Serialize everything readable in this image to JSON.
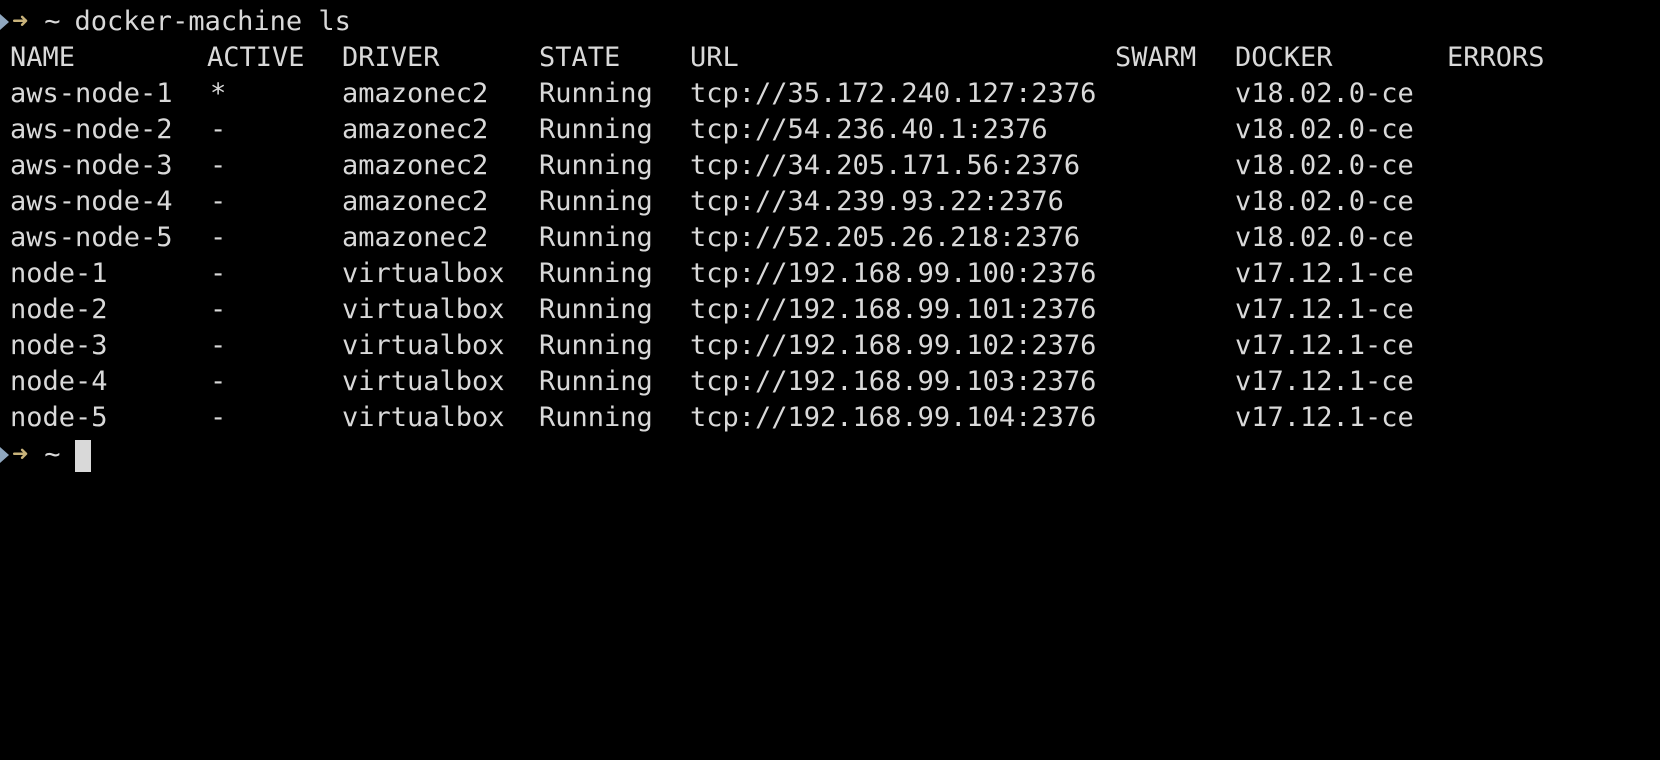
{
  "terminal": {
    "prompt": {
      "arrow": "➜",
      "tilde": "~",
      "command": "docker-machine ls"
    },
    "final_prompt": {
      "arrow": "➜",
      "tilde": "~"
    },
    "columns": [
      "NAME",
      "ACTIVE",
      "DRIVER",
      "STATE",
      "URL",
      "SWARM",
      "DOCKER",
      "ERRORS"
    ],
    "rows": [
      {
        "name": "aws-node-1",
        "active": "*",
        "driver": "amazonec2",
        "state": "Running",
        "url": "tcp://35.172.240.127:2376",
        "swarm": "",
        "docker": "v18.02.0-ce",
        "errors": ""
      },
      {
        "name": "aws-node-2",
        "active": "-",
        "driver": "amazonec2",
        "state": "Running",
        "url": "tcp://54.236.40.1:2376",
        "swarm": "",
        "docker": "v18.02.0-ce",
        "errors": ""
      },
      {
        "name": "aws-node-3",
        "active": "-",
        "driver": "amazonec2",
        "state": "Running",
        "url": "tcp://34.205.171.56:2376",
        "swarm": "",
        "docker": "v18.02.0-ce",
        "errors": ""
      },
      {
        "name": "aws-node-4",
        "active": "-",
        "driver": "amazonec2",
        "state": "Running",
        "url": "tcp://34.239.93.22:2376",
        "swarm": "",
        "docker": "v18.02.0-ce",
        "errors": ""
      },
      {
        "name": "aws-node-5",
        "active": "-",
        "driver": "amazonec2",
        "state": "Running",
        "url": "tcp://52.205.26.218:2376",
        "swarm": "",
        "docker": "v18.02.0-ce",
        "errors": ""
      },
      {
        "name": "node-1",
        "active": "-",
        "driver": "virtualbox",
        "state": "Running",
        "url": "tcp://192.168.99.100:2376",
        "swarm": "",
        "docker": "v17.12.1-ce",
        "errors": ""
      },
      {
        "name": "node-2",
        "active": "-",
        "driver": "virtualbox",
        "state": "Running",
        "url": "tcp://192.168.99.101:2376",
        "swarm": "",
        "docker": "v17.12.1-ce",
        "errors": ""
      },
      {
        "name": "node-3",
        "active": "-",
        "driver": "virtualbox",
        "state": "Running",
        "url": "tcp://192.168.99.102:2376",
        "swarm": "",
        "docker": "v17.12.1-ce",
        "errors": ""
      },
      {
        "name": "node-4",
        "active": "-",
        "driver": "virtualbox",
        "state": "Running",
        "url": "tcp://192.168.99.103:2376",
        "swarm": "",
        "docker": "v17.12.1-ce",
        "errors": ""
      },
      {
        "name": "node-5",
        "active": "-",
        "driver": "virtualbox",
        "state": "Running",
        "url": "tcp://192.168.99.104:2376",
        "swarm": "",
        "docker": "v17.12.1-ce",
        "errors": ""
      }
    ],
    "colors": {
      "background": "#000000",
      "text": "#d9d9d9",
      "prompt_arrow": "#c8b27a",
      "prompt_chevron": "#8fa7bf"
    }
  }
}
